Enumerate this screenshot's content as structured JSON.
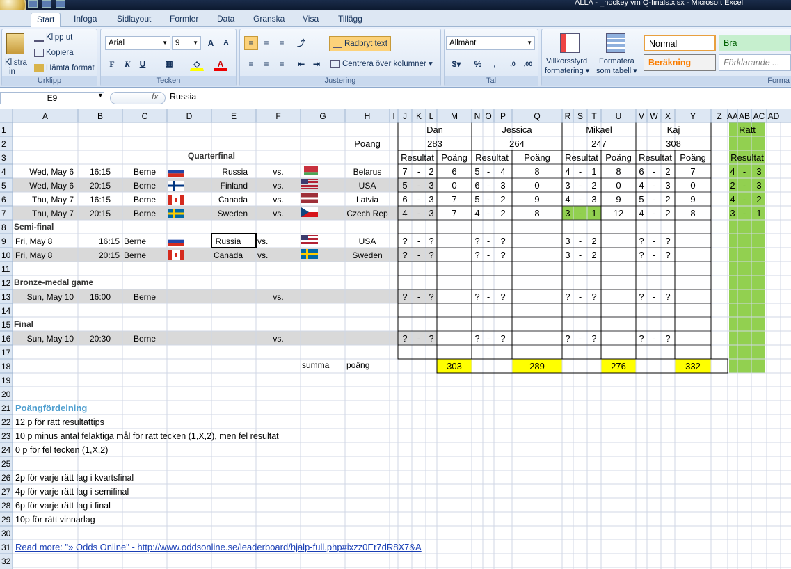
{
  "window": {
    "title": "ALLA - _hockey vm Q-finals.xlsx - Microsoft Excel"
  },
  "tabs": [
    "Start",
    "Infoga",
    "Sidlayout",
    "Formler",
    "Data",
    "Granska",
    "Visa",
    "Tillägg"
  ],
  "active_tab": "Start",
  "ribbon": {
    "clipboard": {
      "paste": "Klistra",
      "paste2": "in",
      "cut": "Klipp ut",
      "copy": "Kopiera",
      "format_painter": "Hämta format",
      "label": "Urklipp"
    },
    "font": {
      "name": "Arial",
      "size": "9",
      "bold": "F",
      "italic": "K",
      "underline": "U",
      "label": "Tecken"
    },
    "alignment": {
      "wrap": "Radbryt text",
      "merge": "Centrera över kolumner",
      "label": "Justering"
    },
    "number": {
      "format": "Allmänt",
      "percent": "%",
      "comma": ",",
      "label": "Tal"
    },
    "styles": {
      "cond": "Villkorsstyrd",
      "cond2": "formatering",
      "table": "Formatera",
      "table2": "som tabell",
      "normal": "Normal",
      "good": "Bra",
      "calc": "Beräkning",
      "explan": "Förklarande ...",
      "label": "Forma"
    }
  },
  "formula_bar": {
    "cell": "E9",
    "fx": "fx",
    "value": "Russia"
  },
  "columns": [
    "A",
    "B",
    "C",
    "D",
    "E",
    "F",
    "G",
    "H",
    "I",
    "J",
    "K",
    "L",
    "M",
    "N",
    "O",
    "P",
    "Q",
    "R",
    "S",
    "T",
    "U",
    "V",
    "W",
    "X",
    "Y",
    "Z",
    "AA",
    "AB",
    "AC",
    "AD"
  ],
  "rows": [
    "1",
    "2",
    "3",
    "4",
    "5",
    "6",
    "7",
    "8",
    "9",
    "10",
    "11",
    "12",
    "13",
    "14",
    "15",
    "16",
    "17",
    "18",
    "19",
    "20",
    "21",
    "22",
    "23",
    "24",
    "25",
    "26",
    "27",
    "28",
    "29",
    "30",
    "31",
    "32"
  ],
  "colors": {
    "yellow": "#ffff00",
    "green": "#92d050",
    "gray": "#d9d9d9",
    "header": "#dde7f3",
    "blue_heading": "#4f9fd0"
  },
  "players": [
    {
      "name": "Dan",
      "total": "283",
      "sum": "303"
    },
    {
      "name": "Jessica",
      "total": "264",
      "sum": "289"
    },
    {
      "name": "Mikael",
      "total": "247",
      "sum": "276"
    },
    {
      "name": "Kaj",
      "total": "308",
      "sum": "332"
    }
  ],
  "correct_header": "Rätt",
  "h_poang": "Poäng",
  "h_resultat": "Resultat",
  "section_titles": {
    "qf": "Quarterfinal",
    "sf": "Semi-final",
    "bronze": "Bronze-medal game",
    "final": "Final"
  },
  "games": [
    {
      "row": "4",
      "date": "Wed, May 6",
      "time": "16:15",
      "venue": "Berne",
      "team1": "Russia",
      "team2": "Belarus",
      "flag1": "russia",
      "flag2": "belarus",
      "vs": "vs.",
      "bets": [
        [
          "7",
          "2",
          "6"
        ],
        [
          "5",
          "4",
          "8"
        ],
        [
          "4",
          "1",
          "8"
        ],
        [
          "6",
          "2",
          "7"
        ]
      ],
      "correct": [
        "4",
        "3"
      ]
    },
    {
      "row": "5",
      "date": "Wed, May 6",
      "time": "20:15",
      "venue": "Berne",
      "team1": "Finland",
      "team2": "USA",
      "flag1": "finland",
      "flag2": "usa",
      "vs": "vs.",
      "bets": [
        [
          "5",
          "3",
          "0"
        ],
        [
          "6",
          "3",
          "0"
        ],
        [
          "3",
          "2",
          "0"
        ],
        [
          "4",
          "3",
          "0"
        ]
      ],
      "correct": [
        "2",
        "3"
      ]
    },
    {
      "row": "6",
      "date": "Thu, May 7",
      "time": "16:15",
      "venue": "Berne",
      "team1": "Canada",
      "team2": "Latvia",
      "flag1": "canada",
      "flag2": "latvia",
      "vs": "vs.",
      "bets": [
        [
          "6",
          "3",
          "7"
        ],
        [
          "5",
          "2",
          "9"
        ],
        [
          "4",
          "3",
          "9"
        ],
        [
          "5",
          "2",
          "9"
        ]
      ],
      "correct": [
        "4",
        "2"
      ]
    },
    {
      "row": "7",
      "date": "Thu, May 7",
      "time": "20:15",
      "venue": "Berne",
      "team1": "Sweden",
      "team2": "Czech Rep",
      "flag1": "sweden",
      "flag2": "czech",
      "vs": "vs.",
      "bets": [
        [
          "4",
          "3",
          "7"
        ],
        [
          "4",
          "2",
          "8"
        ],
        [
          "3",
          "1",
          "12"
        ],
        [
          "4",
          "2",
          "8"
        ]
      ],
      "correct": [
        "3",
        "1"
      ]
    },
    {
      "row": "9",
      "date": "Fri, May 8",
      "time": "16:15",
      "venue": "Berne",
      "team1": "Russia",
      "team2": "USA",
      "flag1": "russia",
      "flag2": "usa",
      "vs": "vs.",
      "bets": [
        [
          "?",
          "?",
          ""
        ],
        [
          "?",
          "?",
          ""
        ],
        [
          "3",
          "2",
          ""
        ],
        [
          "?",
          "?",
          ""
        ]
      ],
      "correct": [
        "",
        ""
      ]
    },
    {
      "row": "10",
      "date": "Fri, May 8",
      "time": "20:15",
      "venue": "Berne",
      "team1": "Canada",
      "team2": "Sweden",
      "flag1": "canada",
      "flag2": "sweden",
      "vs": "vs.",
      "bets": [
        [
          "?",
          "?",
          ""
        ],
        [
          "?",
          "?",
          ""
        ],
        [
          "3",
          "2",
          ""
        ],
        [
          "?",
          "?",
          ""
        ]
      ],
      "correct": [
        "",
        ""
      ]
    },
    {
      "row": "13",
      "date": "Sun, May 10",
      "time": "16:00",
      "venue": "Berne",
      "team1": "",
      "team2": "",
      "flag1": "",
      "flag2": "",
      "vs": "vs.",
      "bets": [
        [
          "?",
          "?",
          ""
        ],
        [
          "?",
          "?",
          ""
        ],
        [
          "?",
          "?",
          ""
        ],
        [
          "?",
          "?",
          ""
        ]
      ],
      "correct": [
        "",
        ""
      ]
    },
    {
      "row": "16",
      "date": "Sun, May 10",
      "time": "20:30",
      "venue": "Berne",
      "team1": "",
      "team2": "",
      "flag1": "",
      "flag2": "",
      "vs": "vs.",
      "bets": [
        [
          "?",
          "?",
          ""
        ],
        [
          "?",
          "?",
          ""
        ],
        [
          "?",
          "?",
          ""
        ],
        [
          "?",
          "?",
          ""
        ]
      ],
      "correct": [
        "",
        ""
      ]
    }
  ],
  "dash": "-",
  "summa": {
    "label": "summa",
    "label2": "poäng"
  },
  "rules": {
    "heading": "Poängfördelning",
    "lines": [
      "12 p för rätt resultattips",
      "10 p minus antal felaktiga mål för rätt tecken (1,X,2), men fel resultat",
      "0 p för fel tecken (1,X,2)",
      "",
      "2p för varje rätt lag i kvartsfinal",
      "4p för varje rätt lag i semifinal",
      "6p för varje rätt lag i final",
      "10p för rätt vinnarlag"
    ],
    "link": "Read more: \"» Odds Online\" - http://www.oddsonline.se/leaderboard/hjalp-full.php#ixzz0Er7dR8X7&A"
  }
}
